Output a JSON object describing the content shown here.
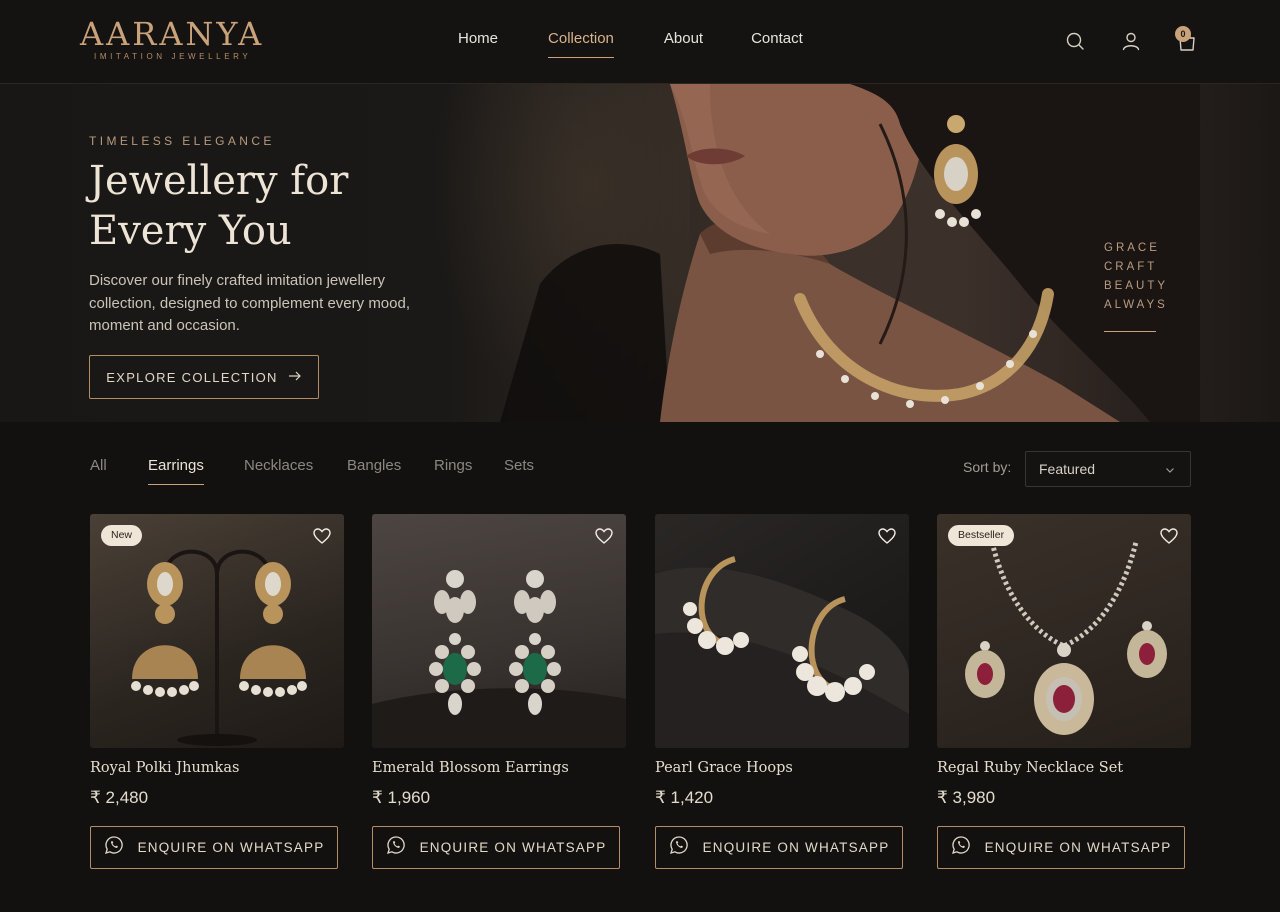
{
  "brand": {
    "name": "AARANYA",
    "tagline": "IMITATION JEWELLERY",
    "accent_color": "#c9a27a"
  },
  "nav": {
    "items": [
      {
        "label": "Home",
        "active": false
      },
      {
        "label": "Collection",
        "active": true
      },
      {
        "label": "About",
        "active": false
      },
      {
        "label": "Contact",
        "active": false
      }
    ]
  },
  "header_icons": {
    "search": "search-icon",
    "account": "user-icon",
    "cart": "shopping-bag-icon",
    "cart_count": "0"
  },
  "hero": {
    "eyebrow": "TIMELESS ELEGANCE",
    "title_line1": "Jewellery for",
    "title_line2": "Every You",
    "description": "Discover our finely crafted imitation jewellery collection, designed to complement every mood, moment and occasion.",
    "cta_label": "EXPLORE COLLECTION",
    "side_words": [
      "GRACE",
      "CRAFT",
      "BEAUTY",
      "ALWAYS"
    ]
  },
  "filters": {
    "tabs": [
      {
        "label": "All",
        "active": false
      },
      {
        "label": "Earrings",
        "active": true
      },
      {
        "label": "Necklaces",
        "active": false
      },
      {
        "label": "Bangles",
        "active": false
      },
      {
        "label": "Rings",
        "active": false
      },
      {
        "label": "Sets",
        "active": false
      }
    ],
    "sort_label": "Sort by:",
    "sort_value": "Featured"
  },
  "products": [
    {
      "name": "Royal Polki Jhumkas",
      "price": "₹ 2,480",
      "badge": "New",
      "button": "ENQUIRE ON WHATSAPP"
    },
    {
      "name": "Emerald Blossom Earrings",
      "price": "₹ 1,960",
      "badge": "",
      "button": "ENQUIRE ON WHATSAPP"
    },
    {
      "name": "Pearl Grace Hoops",
      "price": "₹ 1,420",
      "badge": "",
      "button": "ENQUIRE ON WHATSAPP"
    },
    {
      "name": "Regal Ruby Necklace Set",
      "price": "₹ 3,980",
      "badge": "Bestseller",
      "button": "ENQUIRE ON WHATSAPP"
    }
  ]
}
